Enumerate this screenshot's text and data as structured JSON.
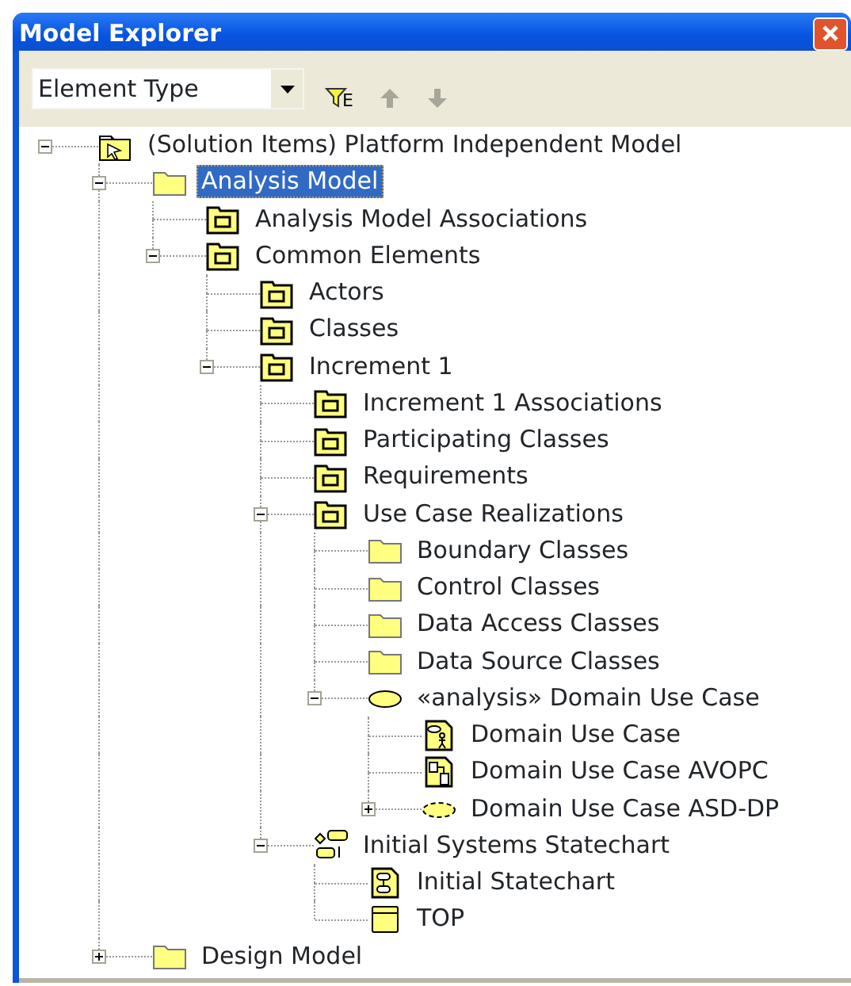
{
  "window": {
    "title": "Model Explorer"
  },
  "toolbar": {
    "dropdown": {
      "value": "Element Type"
    },
    "buttons": [
      {
        "kind": "filter",
        "label": "E",
        "disabled": false
      },
      {
        "kind": "up",
        "disabled": true
      },
      {
        "kind": "down",
        "disabled": true
      }
    ]
  },
  "tree": [
    {
      "label": "(Solution Items) Platform Independent Model",
      "kind": "solution",
      "selected": false,
      "expanded": true,
      "children": [
        {
          "label": "Analysis Model",
          "kind": "folder",
          "selected": true,
          "expanded": true,
          "children": [
            {
              "label": "Analysis Model Associations",
              "kind": "package",
              "selected": false
            },
            {
              "label": "Common Elements",
              "kind": "package",
              "selected": false,
              "expanded": true,
              "children": [
                {
                  "label": "Actors",
                  "kind": "package",
                  "selected": false
                },
                {
                  "label": "Classes",
                  "kind": "package",
                  "selected": false
                },
                {
                  "label": "Increment 1",
                  "kind": "package",
                  "selected": false,
                  "expanded": true,
                  "children": [
                    {
                      "label": "Increment 1 Associations",
                      "kind": "package",
                      "selected": false
                    },
                    {
                      "label": "Participating Classes",
                      "kind": "package",
                      "selected": false
                    },
                    {
                      "label": "Requirements",
                      "kind": "package",
                      "selected": false
                    },
                    {
                      "label": "Use Case Realizations",
                      "kind": "package",
                      "selected": false,
                      "expanded": true,
                      "children": [
                        {
                          "label": "Boundary Classes",
                          "kind": "folder",
                          "selected": false
                        },
                        {
                          "label": "Control Classes",
                          "kind": "folder",
                          "selected": false
                        },
                        {
                          "label": "Data Access Classes",
                          "kind": "folder",
                          "selected": false
                        },
                        {
                          "label": "Data Source Classes",
                          "kind": "folder",
                          "selected": false
                        },
                        {
                          "label": "«analysis» Domain Use Case",
                          "kind": "usecase",
                          "selected": false,
                          "expanded": true,
                          "children": [
                            {
                              "label": "Domain Use Case",
                              "kind": "usecase-diagram",
                              "selected": false
                            },
                            {
                              "label": "Domain Use Case AVOPC",
                              "kind": "class-diagram",
                              "selected": false
                            },
                            {
                              "label": "Domain Use Case ASD-DP",
                              "kind": "collaboration",
                              "selected": false,
                              "expanded": false
                            }
                          ]
                        }
                      ]
                    },
                    {
                      "label": "Initial Systems Statechart",
                      "kind": "statechart",
                      "selected": false,
                      "expanded": true,
                      "children": [
                        {
                          "label": "Initial Statechart",
                          "kind": "statechart-diagram",
                          "selected": false
                        },
                        {
                          "label": "TOP",
                          "kind": "state",
                          "selected": false
                        }
                      ]
                    }
                  ]
                }
              ]
            }
          ]
        },
        {
          "label": "Design Model",
          "kind": "folder",
          "selected": false,
          "expanded": false
        }
      ]
    }
  ]
}
